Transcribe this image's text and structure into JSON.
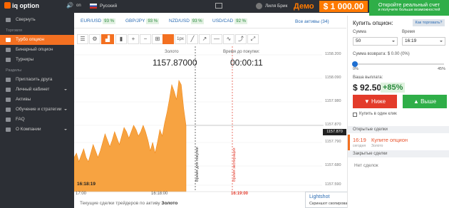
{
  "topbar": {
    "logo": "iq option",
    "sound_icon": "speaker-icon",
    "sound_label": "on",
    "language": "Русский",
    "username": "Лиля Брик",
    "demo_label": "Демо",
    "balance": "$ 1 000.00",
    "real_account_title": "Откройте реальный счет",
    "real_account_sub": "и получите больше возможностей"
  },
  "sidebar": {
    "collapse": "Свернуть",
    "section_trading": "Торговля",
    "items_trading": [
      "Турбо опцион",
      "Бинарный опцион",
      "Турниры"
    ],
    "section_sections": "Разделы",
    "items_sections": [
      "Пригласить друга",
      "Личный кабинет",
      "Активы",
      "Обучение и стратегии",
      "FAQ",
      "О Компании"
    ]
  },
  "assets": {
    "tabs": [
      {
        "name": "EUR/USD",
        "pct": "93 %"
      },
      {
        "name": "GBP/JPY",
        "pct": "93 %"
      },
      {
        "name": "NZD/USD",
        "pct": "93 %"
      },
      {
        "name": "USD/CAD",
        "pct": "92 %"
      }
    ],
    "all_assets": "Все активы (34)"
  },
  "toolbar": {
    "period": "1px"
  },
  "chart_header": {
    "asset": "Золото",
    "price": "1157.87000",
    "countdown_label": "Время до покупки:",
    "countdown": "00:00:11"
  },
  "chart_data": {
    "type": "area",
    "title": "",
    "y_ticks": [
      "1158.200",
      "1158.090",
      "1157.980",
      "1157.870",
      "1157.790",
      "1157.680",
      "1157.590"
    ],
    "current_price": "1157.870",
    "x_ticks": [
      "17:00",
      "16:18:00",
      "16:19:00"
    ],
    "series": [
      {
        "name": "",
        "values": [
          1157.72,
          1157.74,
          1157.7,
          1157.73,
          1157.76,
          1157.72,
          1157.7,
          1157.74,
          1157.78,
          1157.75,
          1157.72,
          1157.75,
          1157.79,
          1157.83,
          1157.8,
          1157.77,
          1157.8,
          1157.84,
          1157.81,
          1157.78,
          1157.82,
          1157.86,
          1157.84,
          1157.81,
          1157.84,
          1157.87,
          1157.85,
          1157.82,
          1157.84,
          1157.87,
          1157.84,
          1157.8,
          1157.75,
          1157.79,
          1157.74,
          1157.79,
          1157.85,
          1157.82,
          1157.88,
          1157.93,
          1157.99,
          1158.06,
          1158.03,
          1157.99,
          1158.08,
          1158.06,
          1157.95,
          1157.87
        ]
      }
    ],
    "ylim": [
      1157.56,
      1158.24
    ],
    "purchase_line_label": "Время для покупки",
    "expiry_line_label": "Время экспирации",
    "time_stamp": "16:18:19"
  },
  "traders": {
    "prefix": "Текущие сделки трейдеров по активу",
    "asset": "Золото"
  },
  "lightshot": {
    "title": "Lightshot",
    "message": "Скриншот скопирован в буфер обмена"
  },
  "panel": {
    "title": "Купить опцион:",
    "how_to": "Как торговать?",
    "amount_label": "Сумма",
    "amount_value": "50",
    "time_label": "Время",
    "time_value": "16:19",
    "return_label": "Сумма возврата: $ 0.00 (0%)",
    "slider_min": "0%",
    "slider_max": "45%",
    "payout_label": "Ваша выплата:",
    "payout_value": "$ 92.50",
    "payout_pct": "+85%",
    "low_button": "Ниже",
    "high_button": "Выше",
    "one_click": "Купить в один клик",
    "open_deals_head": "Открытые сделки",
    "deal_time": "16:19",
    "deal_time_sub": "сегодня",
    "deal_action": "Купите опцион",
    "deal_action_sub": "Золото",
    "closed_deals_head": "Закрытые сделки",
    "no_deals": "Нет сделок"
  }
}
